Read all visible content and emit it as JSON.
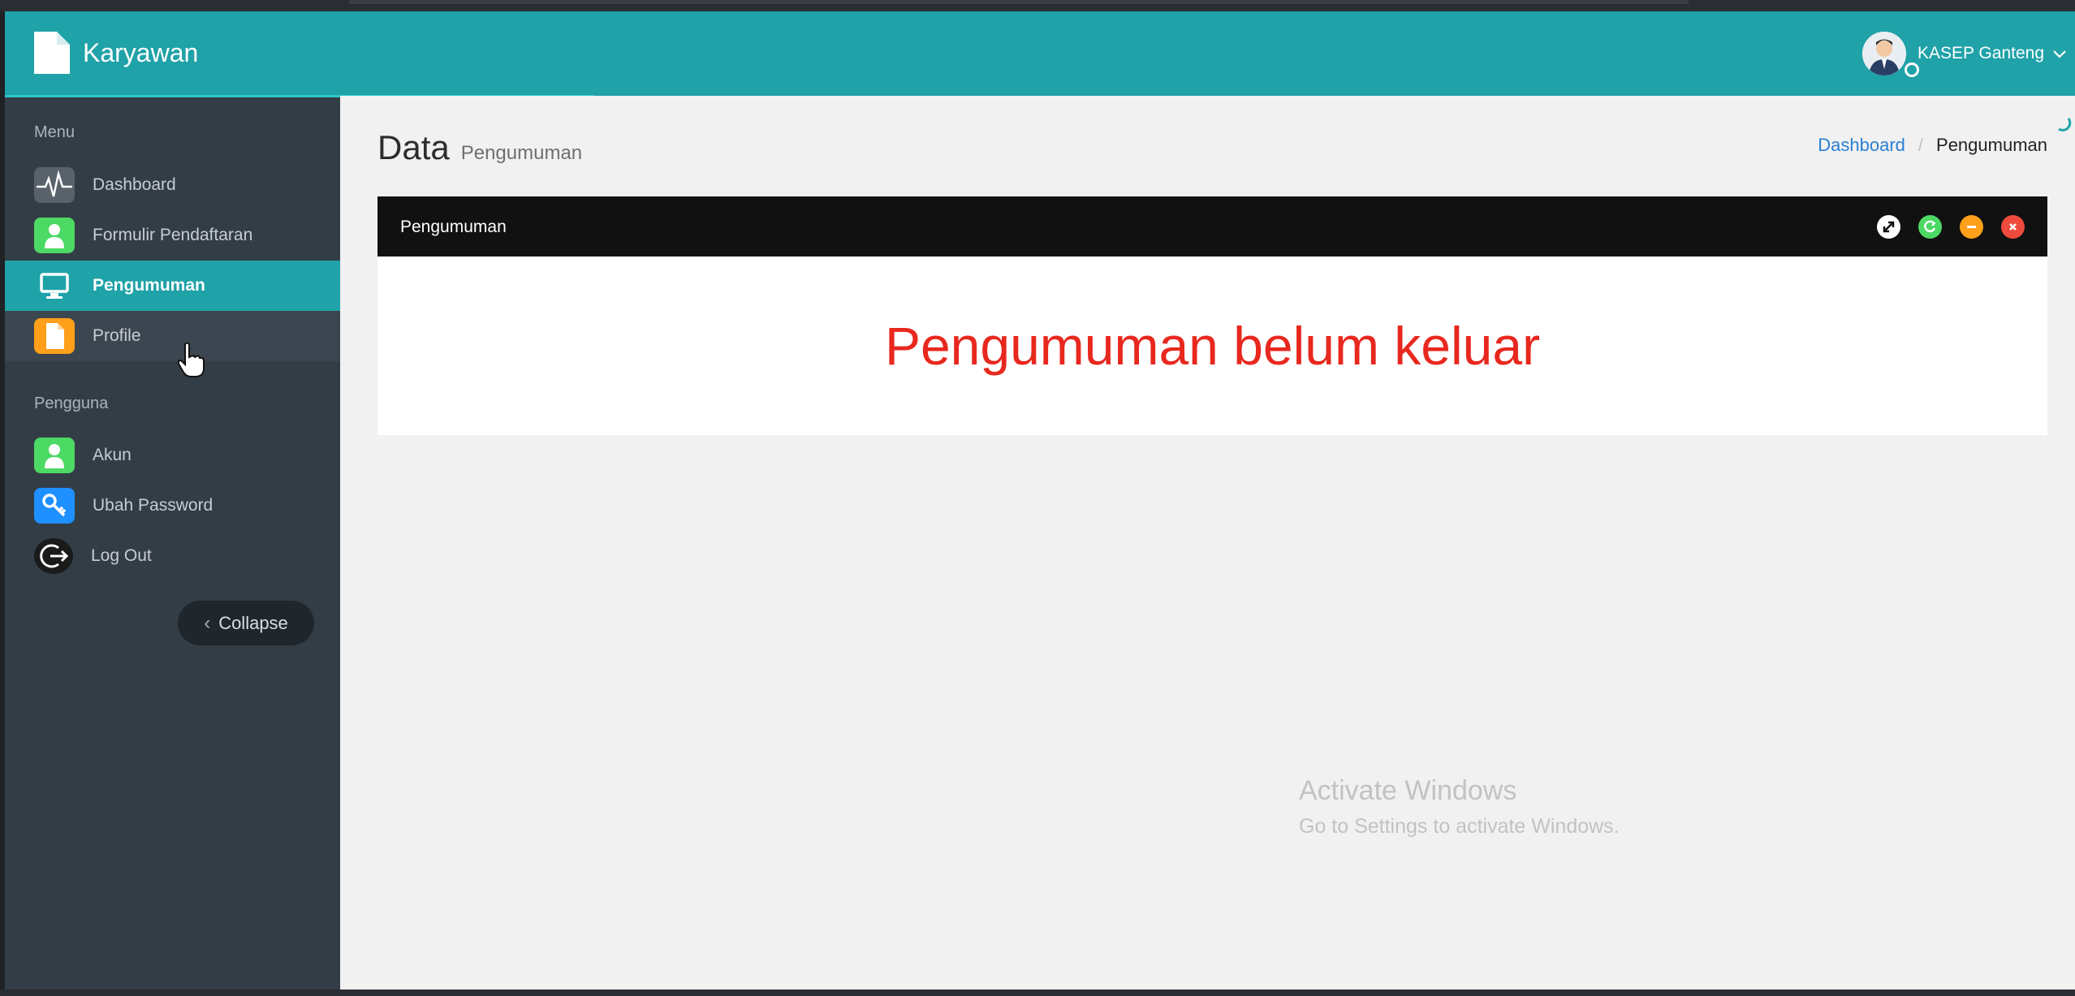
{
  "header": {
    "app_title": "Karyawan",
    "user_name": "KASEP Ganteng"
  },
  "sidebar": {
    "section_menu": "Menu",
    "menu_items": [
      {
        "label": "Dashboard",
        "icon": "pulse-icon",
        "active": false
      },
      {
        "label": "Formulir Pendaftaran",
        "icon": "user-icon",
        "active": false
      },
      {
        "label": "Pengumuman",
        "icon": "monitor-icon",
        "active": true
      },
      {
        "label": "Profile",
        "icon": "document-icon",
        "active": false
      }
    ],
    "section_user": "Pengguna",
    "user_items": [
      {
        "label": "Akun",
        "icon": "user-icon"
      },
      {
        "label": "Ubah Password",
        "icon": "key-icon"
      },
      {
        "label": "Log Out",
        "icon": "logout-icon"
      }
    ],
    "collapse_label": "Collapse"
  },
  "main": {
    "title": "Data",
    "subtitle": "Pengumuman",
    "breadcrumb": [
      "Dashboard",
      "Pengumuman"
    ],
    "panel": {
      "title": "Pengumuman",
      "message": "Pengumuman belum keluar"
    }
  },
  "watermark": {
    "line1": "Activate Windows",
    "line2": "Go to Settings to activate Windows."
  },
  "colors": {
    "header": "#1fa2a8",
    "sidebar": "#333d46",
    "active_item": "#1fa2a8",
    "panel_header": "#111111",
    "message": "#e8281e",
    "link": "#2a7fd4",
    "icon_green": "#4cd964",
    "icon_orange": "#ff9f1a",
    "icon_blue": "#1e90ff",
    "tool_red": "#ef4b3c"
  }
}
